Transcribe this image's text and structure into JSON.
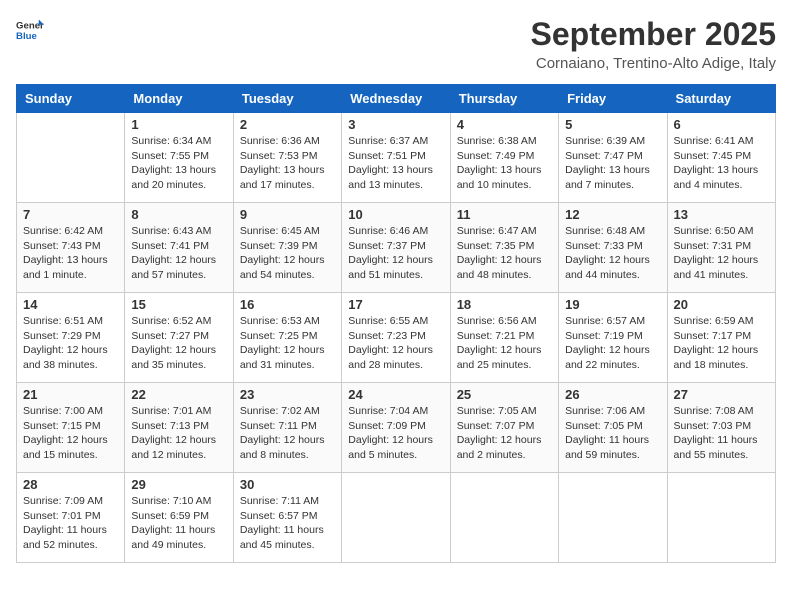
{
  "header": {
    "logo_line1": "General",
    "logo_line2": "Blue",
    "month": "September 2025",
    "location": "Cornaiano, Trentino-Alto Adige, Italy"
  },
  "weekdays": [
    "Sunday",
    "Monday",
    "Tuesday",
    "Wednesday",
    "Thursday",
    "Friday",
    "Saturday"
  ],
  "weeks": [
    [
      {
        "day": "",
        "info": ""
      },
      {
        "day": "1",
        "info": "Sunrise: 6:34 AM\nSunset: 7:55 PM\nDaylight: 13 hours\nand 20 minutes."
      },
      {
        "day": "2",
        "info": "Sunrise: 6:36 AM\nSunset: 7:53 PM\nDaylight: 13 hours\nand 17 minutes."
      },
      {
        "day": "3",
        "info": "Sunrise: 6:37 AM\nSunset: 7:51 PM\nDaylight: 13 hours\nand 13 minutes."
      },
      {
        "day": "4",
        "info": "Sunrise: 6:38 AM\nSunset: 7:49 PM\nDaylight: 13 hours\nand 10 minutes."
      },
      {
        "day": "5",
        "info": "Sunrise: 6:39 AM\nSunset: 7:47 PM\nDaylight: 13 hours\nand 7 minutes."
      },
      {
        "day": "6",
        "info": "Sunrise: 6:41 AM\nSunset: 7:45 PM\nDaylight: 13 hours\nand 4 minutes."
      }
    ],
    [
      {
        "day": "7",
        "info": "Sunrise: 6:42 AM\nSunset: 7:43 PM\nDaylight: 13 hours\nand 1 minute."
      },
      {
        "day": "8",
        "info": "Sunrise: 6:43 AM\nSunset: 7:41 PM\nDaylight: 12 hours\nand 57 minutes."
      },
      {
        "day": "9",
        "info": "Sunrise: 6:45 AM\nSunset: 7:39 PM\nDaylight: 12 hours\nand 54 minutes."
      },
      {
        "day": "10",
        "info": "Sunrise: 6:46 AM\nSunset: 7:37 PM\nDaylight: 12 hours\nand 51 minutes."
      },
      {
        "day": "11",
        "info": "Sunrise: 6:47 AM\nSunset: 7:35 PM\nDaylight: 12 hours\nand 48 minutes."
      },
      {
        "day": "12",
        "info": "Sunrise: 6:48 AM\nSunset: 7:33 PM\nDaylight: 12 hours\nand 44 minutes."
      },
      {
        "day": "13",
        "info": "Sunrise: 6:50 AM\nSunset: 7:31 PM\nDaylight: 12 hours\nand 41 minutes."
      }
    ],
    [
      {
        "day": "14",
        "info": "Sunrise: 6:51 AM\nSunset: 7:29 PM\nDaylight: 12 hours\nand 38 minutes."
      },
      {
        "day": "15",
        "info": "Sunrise: 6:52 AM\nSunset: 7:27 PM\nDaylight: 12 hours\nand 35 minutes."
      },
      {
        "day": "16",
        "info": "Sunrise: 6:53 AM\nSunset: 7:25 PM\nDaylight: 12 hours\nand 31 minutes."
      },
      {
        "day": "17",
        "info": "Sunrise: 6:55 AM\nSunset: 7:23 PM\nDaylight: 12 hours\nand 28 minutes."
      },
      {
        "day": "18",
        "info": "Sunrise: 6:56 AM\nSunset: 7:21 PM\nDaylight: 12 hours\nand 25 minutes."
      },
      {
        "day": "19",
        "info": "Sunrise: 6:57 AM\nSunset: 7:19 PM\nDaylight: 12 hours\nand 22 minutes."
      },
      {
        "day": "20",
        "info": "Sunrise: 6:59 AM\nSunset: 7:17 PM\nDaylight: 12 hours\nand 18 minutes."
      }
    ],
    [
      {
        "day": "21",
        "info": "Sunrise: 7:00 AM\nSunset: 7:15 PM\nDaylight: 12 hours\nand 15 minutes."
      },
      {
        "day": "22",
        "info": "Sunrise: 7:01 AM\nSunset: 7:13 PM\nDaylight: 12 hours\nand 12 minutes."
      },
      {
        "day": "23",
        "info": "Sunrise: 7:02 AM\nSunset: 7:11 PM\nDaylight: 12 hours\nand 8 minutes."
      },
      {
        "day": "24",
        "info": "Sunrise: 7:04 AM\nSunset: 7:09 PM\nDaylight: 12 hours\nand 5 minutes."
      },
      {
        "day": "25",
        "info": "Sunrise: 7:05 AM\nSunset: 7:07 PM\nDaylight: 12 hours\nand 2 minutes."
      },
      {
        "day": "26",
        "info": "Sunrise: 7:06 AM\nSunset: 7:05 PM\nDaylight: 11 hours\nand 59 minutes."
      },
      {
        "day": "27",
        "info": "Sunrise: 7:08 AM\nSunset: 7:03 PM\nDaylight: 11 hours\nand 55 minutes."
      }
    ],
    [
      {
        "day": "28",
        "info": "Sunrise: 7:09 AM\nSunset: 7:01 PM\nDaylight: 11 hours\nand 52 minutes."
      },
      {
        "day": "29",
        "info": "Sunrise: 7:10 AM\nSunset: 6:59 PM\nDaylight: 11 hours\nand 49 minutes."
      },
      {
        "day": "30",
        "info": "Sunrise: 7:11 AM\nSunset: 6:57 PM\nDaylight: 11 hours\nand 45 minutes."
      },
      {
        "day": "",
        "info": ""
      },
      {
        "day": "",
        "info": ""
      },
      {
        "day": "",
        "info": ""
      },
      {
        "day": "",
        "info": ""
      }
    ]
  ]
}
